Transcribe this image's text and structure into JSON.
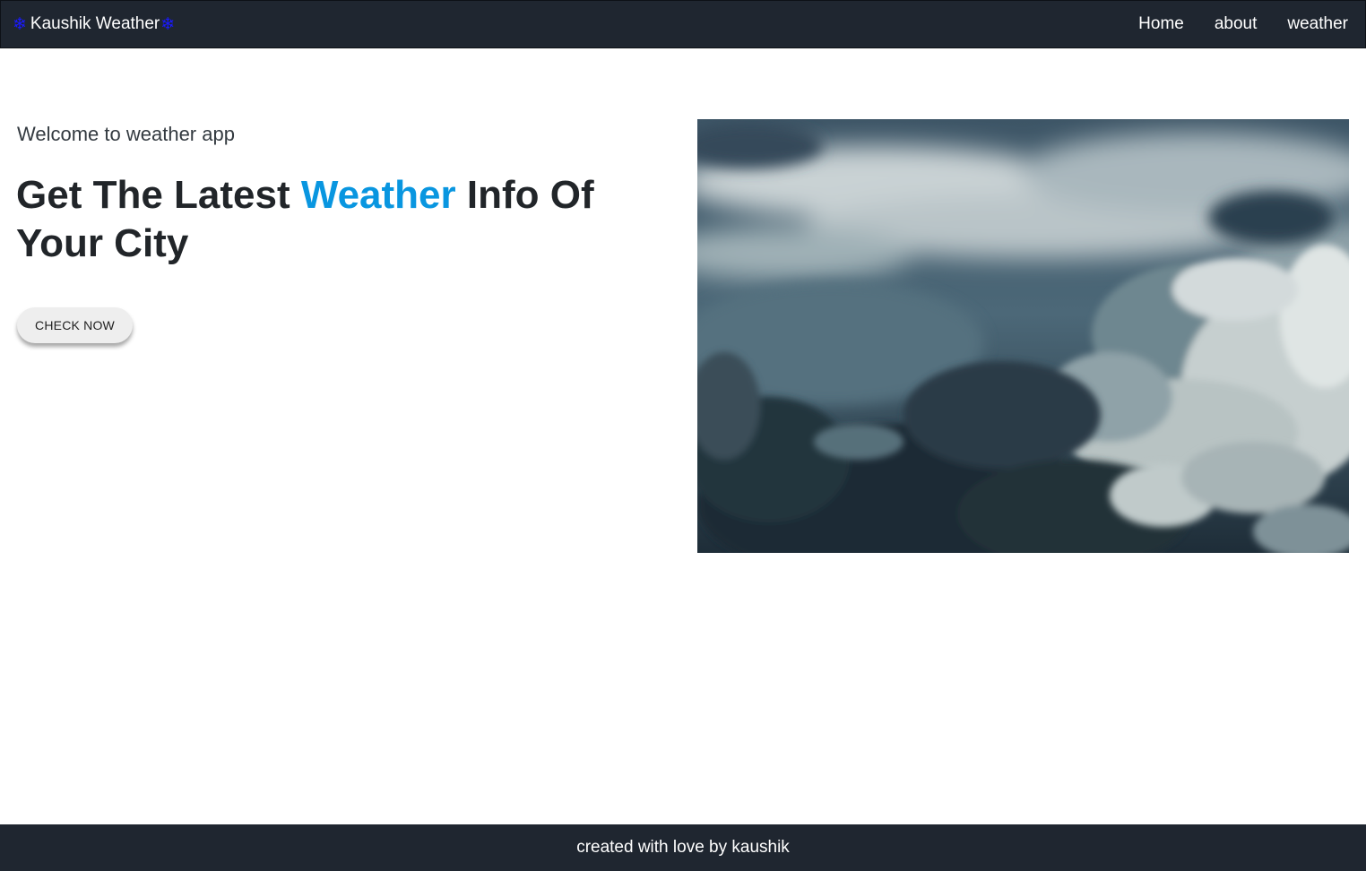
{
  "navbar": {
    "brand_name": "Kaushik Weather",
    "brand_icon": "snowflake-icon",
    "brand_icon_glyph": "❄",
    "links": [
      {
        "label": "Home"
      },
      {
        "label": "about"
      },
      {
        "label": "weather"
      }
    ]
  },
  "hero": {
    "welcome": "Welcome to weather app",
    "headline_before": "Get The Latest ",
    "headline_accent": "Weather",
    "headline_after": " Info Of Your City",
    "cta_label": "CHECK NOW",
    "image_alt": "cloudy sky"
  },
  "footer": {
    "text": "created with love by kaushik"
  },
  "colors": {
    "nav_bg": "#1f2630",
    "accent": "#0996e0",
    "snowflake": "#1a1aff",
    "button_bg": "#eeeeee"
  }
}
